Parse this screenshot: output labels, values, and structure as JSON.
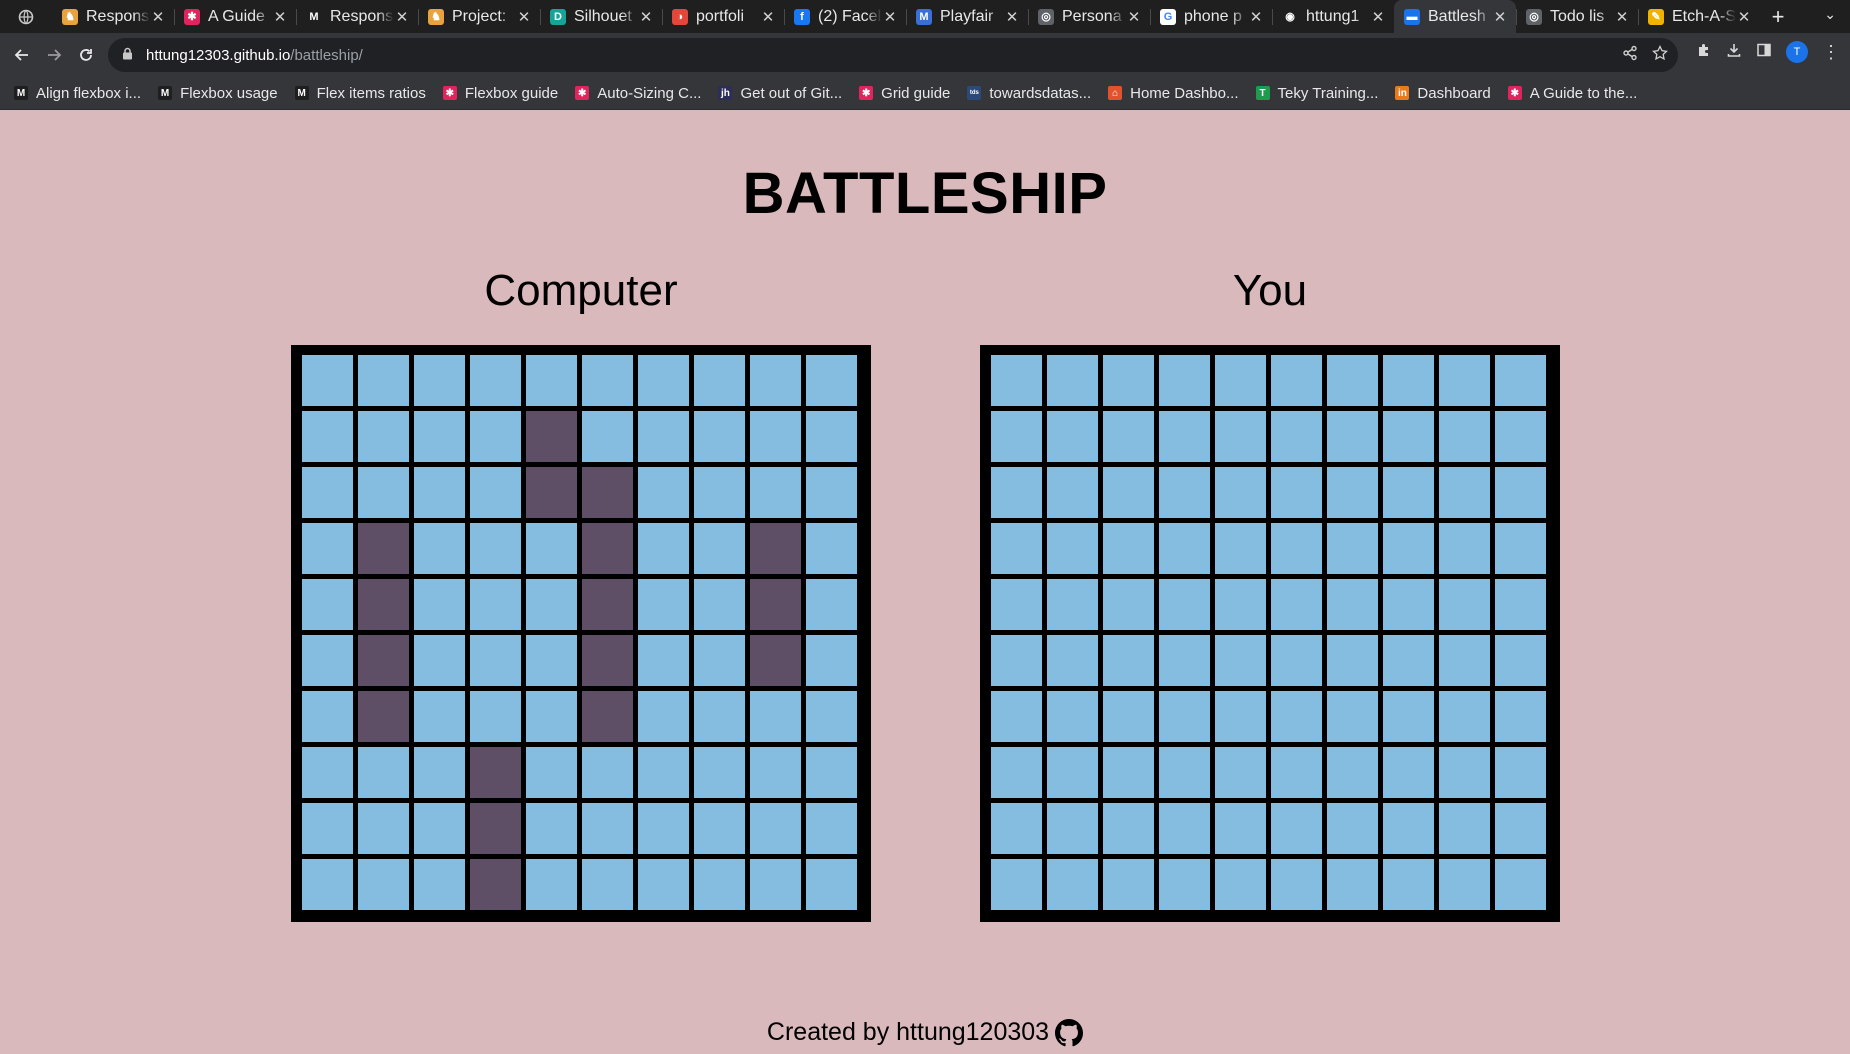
{
  "browser": {
    "tabs": [
      {
        "title": "Respons",
        "fav_color": "#e8a33d",
        "fav_glyph": "♞"
      },
      {
        "title": "A Guide",
        "fav_color": "#e0245e",
        "fav_glyph": "✱"
      },
      {
        "title": "Respons",
        "fav_color": "#1f1f1f",
        "fav_glyph": "M"
      },
      {
        "title": "Project:",
        "fav_color": "#e8a33d",
        "fav_glyph": "♞"
      },
      {
        "title": "Silhouet",
        "fav_color": "#17a398",
        "fav_glyph": "D"
      },
      {
        "title": "portfoli",
        "fav_color": "#e5463b",
        "fav_glyph": "◑"
      },
      {
        "title": "(2) Facel",
        "fav_color": "#1877f2",
        "fav_glyph": "f"
      },
      {
        "title": "Playfair",
        "fav_color": "#3a6fd8",
        "fav_glyph": "M"
      },
      {
        "title": "Persona",
        "fav_color": "#5f6368",
        "fav_glyph": "◎"
      },
      {
        "title": "phone p",
        "fav_color": "#ffffff",
        "fav_glyph": "G"
      },
      {
        "title": "httung1",
        "fav_color": "#1f1f1f",
        "fav_glyph": "◉"
      },
      {
        "title": "Battlesh",
        "fav_color": "#1a73e8",
        "fav_glyph": "▬",
        "active": true
      },
      {
        "title": "Todo lis",
        "fav_color": "#5f6368",
        "fav_glyph": "◎"
      },
      {
        "title": "Etch-A-S",
        "fav_color": "#f0b400",
        "fav_glyph": "✎"
      }
    ],
    "url_host": "httung12303.github.io",
    "url_path": "/battleship/",
    "profile_initial": "T",
    "bookmarks": [
      {
        "label": "Align flexbox i...",
        "fav_color": "#1f1f1f",
        "fav_glyph": "M"
      },
      {
        "label": "Flexbox usage",
        "fav_color": "#1f1f1f",
        "fav_glyph": "M"
      },
      {
        "label": "Flex items ratios",
        "fav_color": "#1f1f1f",
        "fav_glyph": "M"
      },
      {
        "label": "Flexbox guide",
        "fav_color": "#e0245e",
        "fav_glyph": "✱"
      },
      {
        "label": "Auto-Sizing C...",
        "fav_color": "#e0245e",
        "fav_glyph": "✱"
      },
      {
        "label": "Get out of Git...",
        "fav_color": "#2d2d5a",
        "fav_glyph": "jh"
      },
      {
        "label": "Grid guide",
        "fav_color": "#e0245e",
        "fav_glyph": "✱"
      },
      {
        "label": "towardsdatas...",
        "fav_color": "#2b4a7a",
        "fav_glyph": "tds"
      },
      {
        "label": "Home Dashbo...",
        "fav_color": "#e2532d",
        "fav_glyph": "⌂"
      },
      {
        "label": "Teky Training...",
        "fav_color": "#1e9c4d",
        "fav_glyph": "T"
      },
      {
        "label": "Dashboard",
        "fav_color": "#e87b1e",
        "fav_glyph": "in"
      },
      {
        "label": "A Guide to the...",
        "fav_color": "#e0245e",
        "fav_glyph": "✱"
      }
    ]
  },
  "page": {
    "title": "BATTLESHIP",
    "boards": [
      {
        "name": "Computer",
        "cells": [
          "..........",
          "....#.....",
          "....##....",
          ".#...#..#.",
          ".#...#..#.",
          ".#...#..#.",
          ".#...#....",
          "...#......",
          "...#......",
          "...#......"
        ]
      },
      {
        "name": "You",
        "cells": [
          "..........",
          "..........",
          "..........",
          "..........",
          "..........",
          "..........",
          "..........",
          "..........",
          "..........",
          ".........."
        ]
      }
    ],
    "footer_text": "Created by httung120303"
  },
  "colors": {
    "background": "#dab9bc",
    "water": "#85bde0",
    "ship": "#5e4f66",
    "grid": "#000000"
  }
}
